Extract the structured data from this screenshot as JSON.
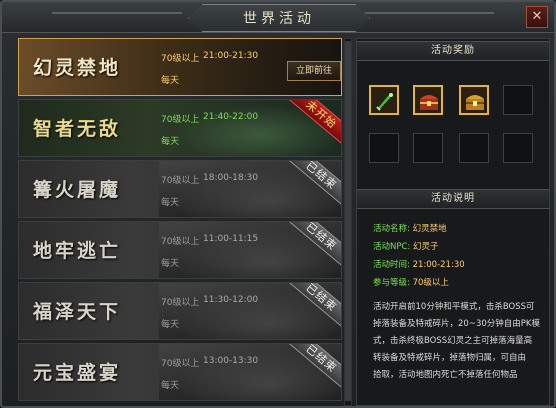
{
  "window": {
    "title": "世界活动",
    "close": "✕"
  },
  "activities": [
    {
      "name": "幻灵禁地",
      "level": "70级以上",
      "time": "21:00-21:30",
      "freq": "每天",
      "status": "",
      "button": "立即前往"
    },
    {
      "name": "智者无敌",
      "level": "70级以上",
      "time": "21:40-22:00",
      "freq": "每天",
      "status": "未开始"
    },
    {
      "name": "篝火屠魔",
      "level": "70级以上",
      "time": "18:00-18:30",
      "freq": "每天",
      "status": "已结束"
    },
    {
      "name": "地牢逃亡",
      "level": "70级以上",
      "time": "11:00-11:15",
      "freq": "每天",
      "status": "已结束"
    },
    {
      "name": "福泽天下",
      "level": "70级以上",
      "time": "11:30-12:00",
      "freq": "每天",
      "status": "已结束"
    },
    {
      "name": "元宝盛宴",
      "level": "70级以上",
      "time": "13:00-13:30",
      "freq": "每天",
      "status": "已结束"
    }
  ],
  "rewards": {
    "title": "活动奖励",
    "slots": [
      {
        "icon": "green-sword-icon",
        "filled": true
      },
      {
        "icon": "red-chest-icon",
        "filled": true
      },
      {
        "icon": "gold-chest-icon",
        "filled": true
      },
      {
        "icon": "",
        "filled": false
      },
      {
        "icon": "",
        "filled": false
      },
      {
        "icon": "",
        "filled": false
      },
      {
        "icon": "",
        "filled": false
      },
      {
        "icon": "",
        "filled": false
      }
    ]
  },
  "description": {
    "title": "活动说明",
    "name_label": "活动名称:",
    "name_value": "幻灵禁地",
    "npc_label": "活动NPC:",
    "npc_value": "幻灵子",
    "time_label": "活动时间:",
    "time_value": "21:00-21:30",
    "level_label": "参与等级:",
    "level_value": "70级以上",
    "body": [
      "活动开启前10分钟和平模式，击杀BOSS可",
      "掉落装备及特戒碎片，20~30分钟自由PK模",
      "式，击杀终极BOSS幻灵之主可掉落海量高",
      "转装备及特戒碎片，掉落物归属，可自由",
      "拾取，活动地图内死亡不掉落任何物品"
    ]
  }
}
